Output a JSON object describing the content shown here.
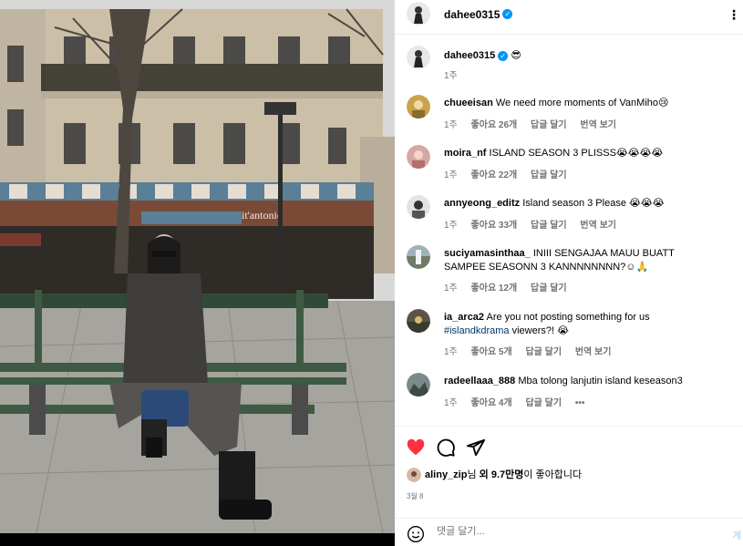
{
  "post": {
    "username": "dahee0315",
    "verified": true,
    "caption_emoji": "😎",
    "caption_time": "1주"
  },
  "comments": [
    {
      "user": "chueeisan",
      "text": "We need more moments of VanMiho😢",
      "time": "1주",
      "likes": "좋아요 26개",
      "reply": "답글 달기",
      "translate": "번역 보기"
    },
    {
      "user": "moira_nf",
      "text": "ISLAND SEASON 3 PLISSS😭😭😭😭",
      "time": "1주",
      "likes": "좋아요 22개",
      "reply": "답글 달기",
      "translate": ""
    },
    {
      "user": "annyeong_editz",
      "text": "Island season 3 Please 😭😭😭",
      "time": "1주",
      "likes": "좋아요 33개",
      "reply": "답글 달기",
      "translate": "번역 보기"
    },
    {
      "user": "suciyamasinthaa_",
      "text": "INIII SENGAJAA MAUU BUATT SAMPEE SEASONN 3 KANNNNNNNN?☺🙏",
      "time": "1주",
      "likes": "좋아요 12개",
      "reply": "답글 달기",
      "translate": ""
    },
    {
      "user": "ia_arca2",
      "text": "Are you not posting something for us",
      "hashtag": "#islandkdrama",
      "text2": "viewers?! 😭",
      "time": "1주",
      "likes": "좋아요 5개",
      "reply": "답글 달기",
      "translate": "번역 보기"
    },
    {
      "user": "radeellaaa_888",
      "text": "Mba tolong lanjutin island keseason3",
      "time": "1주",
      "likes": "좋아요 4개",
      "reply": "답글 달기",
      "more": "•••"
    }
  ],
  "likes": {
    "liker": "aliny_zip",
    "text_a": "님 ",
    "text_b": "외 9.7만명",
    "text_c": "이 좋아합니다"
  },
  "date": "3월 8",
  "add_comment": {
    "placeholder": "댓글 달기...",
    "post_label": "게"
  },
  "colors": {
    "like_red": "#ff3040",
    "verified_blue": "#0095f6",
    "hashtag": "#00376b",
    "meta_gray": "#737373"
  },
  "icons": [
    "heart-icon",
    "comment-icon",
    "share-icon",
    "emoji-icon",
    "verified-icon",
    "more-icon"
  ]
}
